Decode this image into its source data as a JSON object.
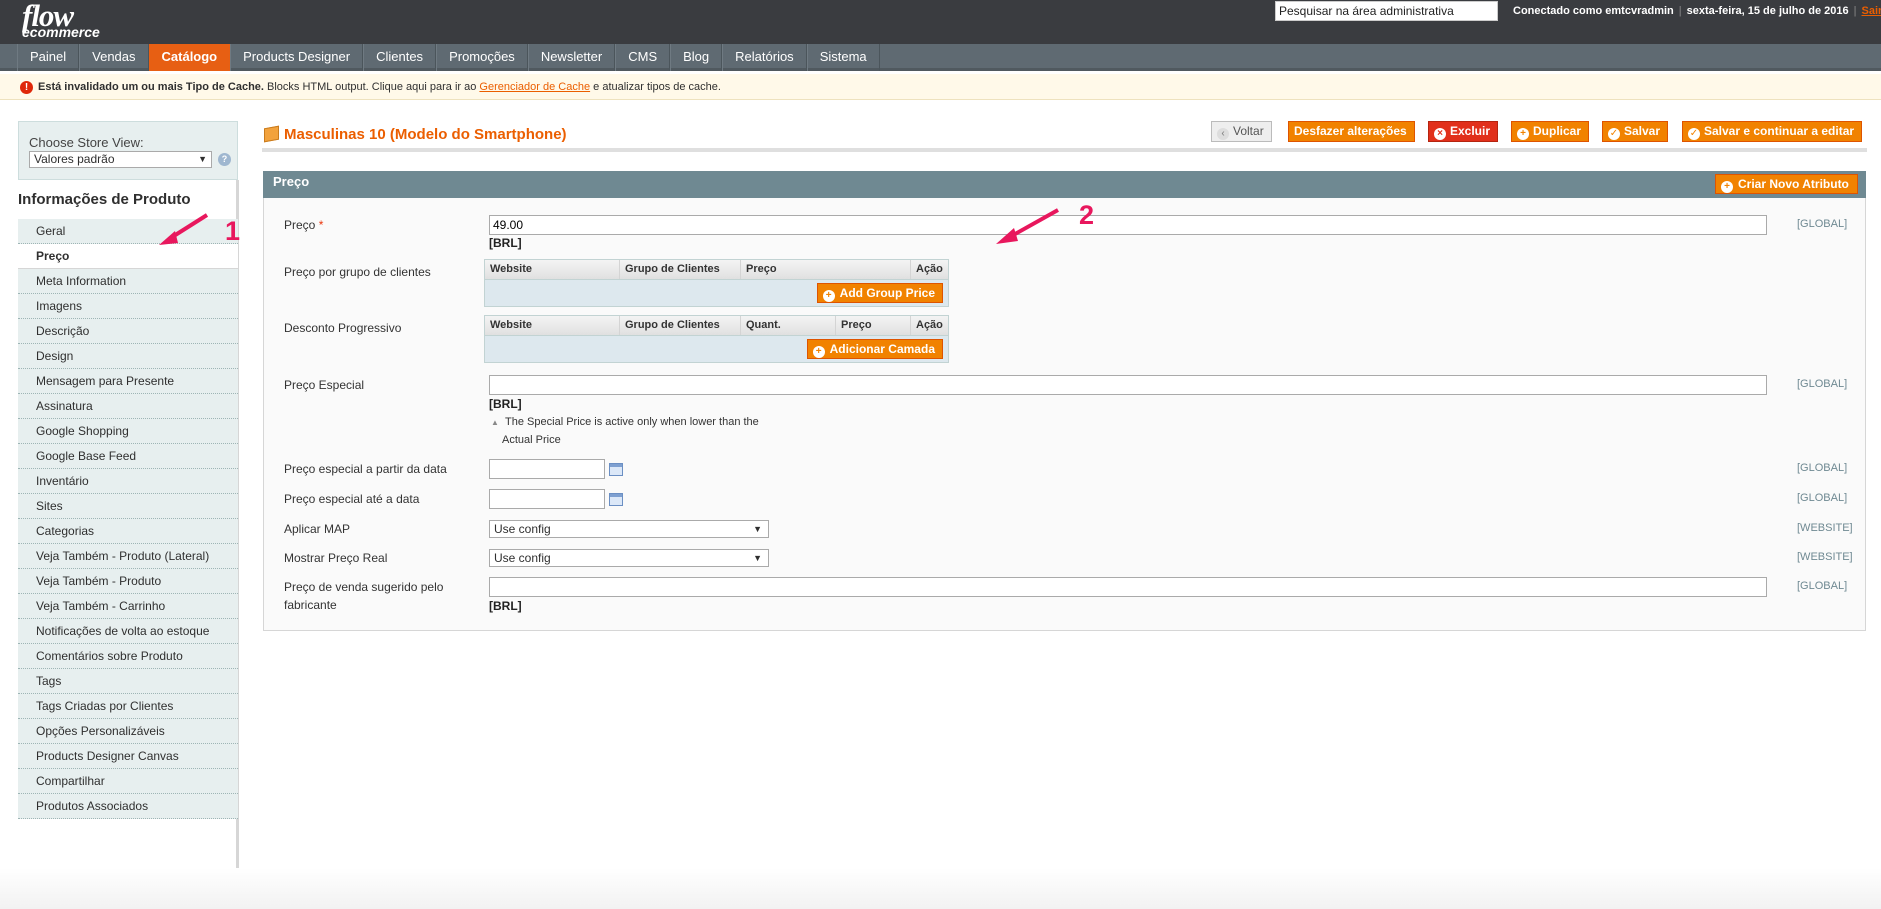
{
  "header": {
    "logo_line1": "flow",
    "logo_line2": "ecommerce",
    "search_value": "Pesquisar na área administrativa",
    "logged_in": "Conectado como emtcvradmin",
    "date": "sexta-feira, 15 de julho de 2016",
    "logout": "Sair"
  },
  "nav": {
    "items": [
      "Painel",
      "Vendas",
      "Catálogo",
      "Products Designer",
      "Clientes",
      "Promoções",
      "Newsletter",
      "CMS",
      "Blog",
      "Relatórios",
      "Sistema"
    ],
    "active": "Catálogo"
  },
  "notice": {
    "bold": "Está invalidado um ou mais Tipo de Cache.",
    "text1": "Blocks HTML output. Clique aqui para ir ao",
    "link": "Gerenciador de Cache",
    "text2": "e atualizar tipos de cache."
  },
  "store_view": {
    "label": "Choose Store View:",
    "value": "Valores padrão"
  },
  "sidebar": {
    "title": "Informações de Produto",
    "tabs": [
      "Geral",
      "Preço",
      "Meta Information",
      "Imagens",
      "Descrição",
      "Design",
      "Mensagem para Presente",
      "Assinatura",
      "Google Shopping",
      "Google Base Feed",
      "Inventário",
      "Sites",
      "Categorias",
      "Veja Também - Produto (Lateral)",
      "Veja Também - Produto",
      "Veja Também - Carrinho",
      "Notificações de volta ao estoque",
      "Comentários sobre Produto",
      "Tags",
      "Tags Criadas por Clientes",
      "Opções Personalizáveis",
      "Products Designer Canvas",
      "Compartilhar",
      "Produtos Associados"
    ],
    "active": "Preço"
  },
  "page": {
    "title": "Masculinas 10 (Modelo do Smartphone)",
    "buttons": {
      "back": "Voltar",
      "reset": "Desfazer alterações",
      "delete": "Excluir",
      "duplicate": "Duplicar",
      "save": "Salvar",
      "save_continue": "Salvar e continuar a editar"
    }
  },
  "section": {
    "title": "Preço",
    "new_attribute": "Criar Novo Atributo",
    "price": {
      "label": "Preço",
      "required": "*",
      "value": "49.00",
      "currency": "[BRL]",
      "scope": "[GLOBAL]"
    },
    "group_price": {
      "label": "Preço por grupo de clientes",
      "columns": [
        "Website",
        "Grupo de Clientes",
        "Preço",
        "Ação"
      ],
      "button": "Add Group Price"
    },
    "tier_price": {
      "label": "Desconto Progressivo",
      "columns": [
        "Website",
        "Grupo de Clientes",
        "Quant.",
        "Preço",
        "Ação"
      ],
      "button": "Adicionar Camada"
    },
    "special_price": {
      "label": "Preço Especial",
      "value": "",
      "currency": "[BRL]",
      "note1": "The Special Price is active only when lower than the",
      "note2": "Actual Price",
      "scope": "[GLOBAL]"
    },
    "special_from": {
      "label": "Preço especial a partir da data",
      "value": "",
      "scope": "[GLOBAL]"
    },
    "special_to": {
      "label": "Preço especial até a data",
      "value": "",
      "scope": "[GLOBAL]"
    },
    "apply_map": {
      "label": "Aplicar MAP",
      "value": "Use config",
      "scope": "[WEBSITE]"
    },
    "show_real_price": {
      "label": "Mostrar Preço Real",
      "value": "Use config",
      "scope": "[WEBSITE]"
    },
    "msrp": {
      "label1": "Preço de venda sugerido pelo",
      "label2": "fabricante",
      "value": "",
      "currency": "[BRL]",
      "scope": "[GLOBAL]"
    }
  },
  "annotations": {
    "one": "1",
    "two": "2"
  },
  "colors": {
    "accent": "#eb5e00",
    "button": "#f18200",
    "section": "#6f8992",
    "annotation": "#e8175d"
  }
}
